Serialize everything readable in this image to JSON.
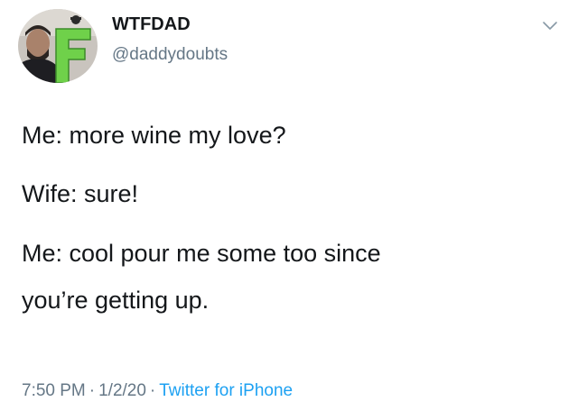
{
  "author": {
    "display_name": "WTFDAD",
    "handle": "@daddydoubts",
    "avatar_icon": "profile-avatar-photo"
  },
  "menu_icon": "chevron-down-icon",
  "tweet": {
    "lines": [
      "Me: more wine my love?",
      "Wife: sure!",
      "Me: cool pour me some too since",
      "you’re getting up."
    ]
  },
  "meta": {
    "time": "7:50 PM",
    "date": "1/2/20",
    "separator": "·",
    "source": "Twitter for iPhone"
  },
  "colors": {
    "text": "#14171a",
    "secondary": "#657786",
    "link": "#1da1f2",
    "avatar_letter": "#6fd14a"
  }
}
